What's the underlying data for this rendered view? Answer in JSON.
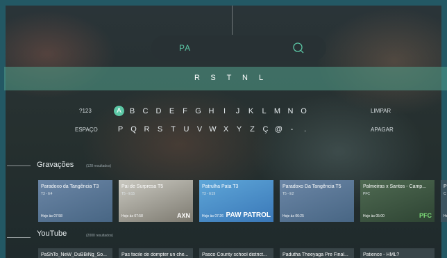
{
  "search": {
    "query": "PA"
  },
  "suggestions": [
    "R",
    "S",
    "T",
    "N",
    "L"
  ],
  "keyboard": {
    "row1_side": "?123",
    "row1_keys": [
      "A",
      "B",
      "C",
      "D",
      "E",
      "F",
      "G",
      "H",
      "I",
      "J",
      "K",
      "L",
      "M",
      "N",
      "O"
    ],
    "row1_action": "LIMPAR",
    "row2_side": "ESPAÇO",
    "row2_keys": [
      "P",
      "Q",
      "R",
      "S",
      "T",
      "U",
      "V",
      "W",
      "X",
      "Y",
      "Z",
      "Ç",
      "@",
      "-",
      "."
    ],
    "row2_action": "APAGAR",
    "active_key": "A"
  },
  "recordings": {
    "title": "Gravações",
    "count": "(128 resultados)",
    "cards": [
      {
        "title": "Paradoxo da Tangência T3",
        "sub": "T3 - E4",
        "time": "Hoje às 07:58",
        "art": ""
      },
      {
        "title": "Pai de Surpresa T5",
        "sub": "T5 - E15",
        "time": "Hoje às 07:58",
        "art": "AXN"
      },
      {
        "title": "Patrulha Pata T3",
        "sub": "T3 - E19",
        "time": "Hoje às 07:26",
        "art": "PAW PATROL"
      },
      {
        "title": "Paradoxo Da Tangência T5",
        "sub": "T5 - E2",
        "time": "Hoje às 06:25",
        "art": ""
      },
      {
        "title": "Palmeiras x Santos - Camp...",
        "sub": "PFC",
        "time": "Hoje às 05:00",
        "art": "PFC"
      },
      {
        "title": "P",
        "sub": "C",
        "time": "Ho",
        "art": ""
      }
    ]
  },
  "youtube": {
    "title": "YouTube",
    "count": "(2000 resultados)",
    "cards": [
      {
        "title": "PaShTo_NeW_DuBBiNg_So..."
      },
      {
        "title": "Pas facile de dompter un che..."
      },
      {
        "title": "Pasco County school district..."
      },
      {
        "title": "Padutha Theeyaga Pre Final..."
      },
      {
        "title": "Patience - HML?"
      }
    ]
  }
}
